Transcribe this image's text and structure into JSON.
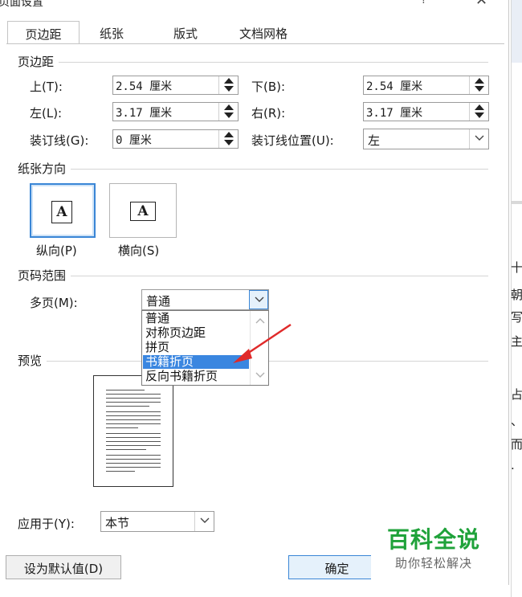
{
  "window": {
    "title": "页面设置",
    "help": "?",
    "close": "✕"
  },
  "tabs": [
    "页边距",
    "纸张",
    "版式",
    "文档网格"
  ],
  "margins": {
    "group_label": "页边距",
    "top_label": "上(T):",
    "top_value": "2.54 厘米",
    "bottom_label": "下(B):",
    "bottom_value": "2.54 厘米",
    "left_label": "左(L):",
    "left_value": "3.17 厘米",
    "right_label": "右(R):",
    "right_value": "3.17 厘米",
    "gutter_label": "装订线(G):",
    "gutter_value": "0 厘米",
    "gutter_pos_label": "装订线位置(U):",
    "gutter_pos_value": "左"
  },
  "orientation": {
    "group_label": "纸张方向",
    "portrait_label": "纵向(P)",
    "landscape_label": "横向(S)",
    "icon_letter": "A",
    "selected": "portrait"
  },
  "pages": {
    "group_label": "页码范围",
    "multiple_label": "多页(M):",
    "multiple_value": "普通",
    "options": [
      "普通",
      "对称页边距",
      "拼页",
      "书籍折页",
      "反向书籍折页"
    ],
    "highlighted": "书籍折页"
  },
  "preview": {
    "group_label": "预览"
  },
  "apply": {
    "label": "应用于(Y):",
    "value": "本节"
  },
  "buttons": {
    "default": "设为默认值(D)",
    "ok": "确定"
  },
  "background_text": [
    "十",
    "朝",
    "写",
    "主",
    "占",
    "、",
    "而",
    "."
  ],
  "watermark": {
    "line1": "百科全说",
    "line2": "助你轻松解决"
  },
  "colors": {
    "accent": "#3a86e0",
    "arrow": "#e02a2a",
    "watermark": "#1fa23a"
  }
}
